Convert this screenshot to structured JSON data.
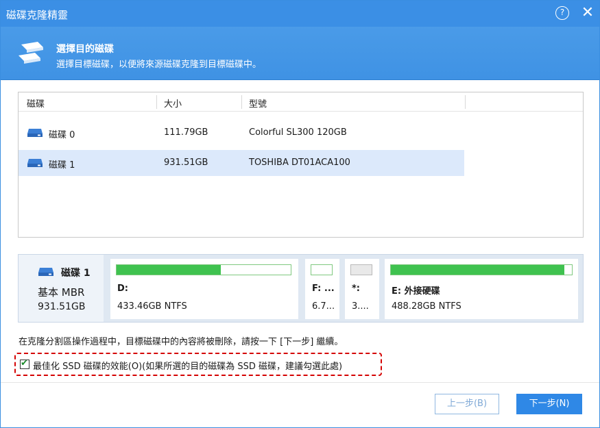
{
  "window": {
    "title": "磁碟克隆精靈",
    "help_symbol": "?",
    "close_symbol": "✕"
  },
  "header": {
    "title": "選擇目的磁碟",
    "subtitle": "選擇目標磁碟，以便將來源磁碟克隆到目標磁碟中。",
    "icon": "disks-icon"
  },
  "table": {
    "columns": [
      "磁碟",
      "大小",
      "型號"
    ],
    "rows": [
      {
        "disk": "磁碟 0",
        "size": "111.79GB",
        "model": "Colorful SL300 120GB",
        "selected": false
      },
      {
        "disk": "磁碟 1",
        "size": "931.51GB",
        "model": "TOSHIBA DT01ACA100",
        "selected": true
      }
    ]
  },
  "disk_panel": {
    "name": "磁碟 1",
    "type": "基本 MBR",
    "size": "931.51GB",
    "partitions": [
      {
        "label": "D:",
        "info": "433.46GB NTFS",
        "usage": 0.6
      },
      {
        "label": "F: ...",
        "info": "6.7...",
        "usage": 0.0
      },
      {
        "label": "*:",
        "info": "3....",
        "usage": 0.0
      },
      {
        "label": "E: 外接硬碟",
        "info": "488.28GB NTFS",
        "usage": 0.96
      }
    ]
  },
  "note": "在克隆分割區操作過程中，目標磁碟中的內容將被刪除，請按一下 [下一步] 繼續。",
  "ssd_option": {
    "checked": true,
    "label": "最佳化 SSD 磁碟的效能(O)(如果所選的目的磁碟為 SSD 磁碟，建議勾選此處)"
  },
  "buttons": {
    "back": "上一步(B)",
    "next": "下一步(N)"
  },
  "colors": {
    "accent": "#3b8fe5",
    "selected_row": "#dce9fb",
    "usage_fill": "#3fc24f",
    "highlight_border": "#d40000"
  }
}
